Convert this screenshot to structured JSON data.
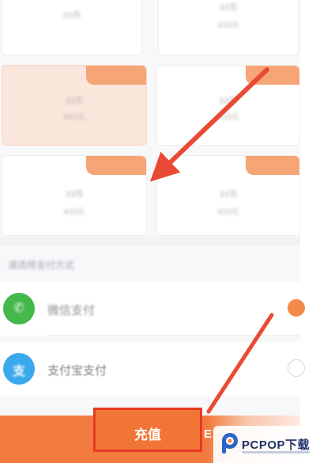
{
  "packages": [
    {
      "coins": "33币",
      "price": "¥33元",
      "tag": "",
      "selected": false
    },
    {
      "coins": "33币",
      "price": "¥33元",
      "tag": "",
      "selected": false
    },
    {
      "coins": "33币",
      "price": "¥33元",
      "tag": "",
      "selected": true
    },
    {
      "coins": "33币",
      "price": "¥33元",
      "tag": "",
      "selected": false
    },
    {
      "coins": "33币",
      "price": "¥33元",
      "tag": "",
      "selected": false
    },
    {
      "coins": "33币",
      "price": "¥33元",
      "tag": "",
      "selected": false
    }
  ],
  "payment": {
    "section_title": "请选择支付方式",
    "wechat_label": "微信支付",
    "wechat_icon": "wechat-icon",
    "alipay_label": "支付宝支付",
    "alipay_icon": "alipay-icon",
    "alipay_glyph": "支",
    "wechat_glyph": "✆",
    "selected_method": "wechat"
  },
  "footer": {
    "recharge_label": "充值",
    "side_glyph": "E"
  },
  "watermark": {
    "text": "PCPOP下载"
  },
  "colors": {
    "accent": "#f27a3e",
    "annotation_red": "#e63a26",
    "selected_card": "#fbe6dc",
    "wechat_green": "#43b84b",
    "alipay_blue": "#3aa8ec"
  }
}
